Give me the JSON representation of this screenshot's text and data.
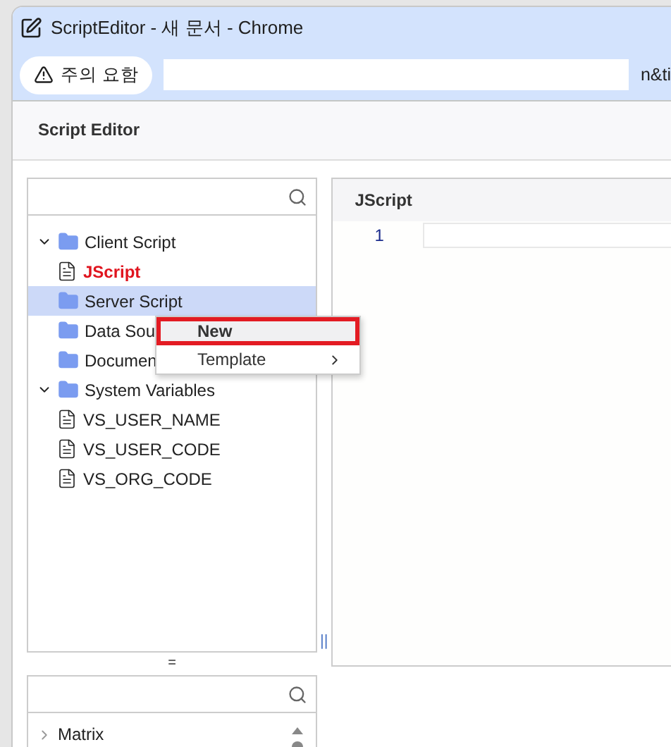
{
  "window": {
    "title": "ScriptEditor - 새 문서 - Chrome"
  },
  "address_bar": {
    "warning": "주의 요함",
    "url_tail": "n&ti"
  },
  "app": {
    "title": "Script Editor"
  },
  "tree": {
    "items": [
      {
        "label": "Client Script",
        "kind": "folder",
        "expanded": true,
        "selected": false,
        "children": [
          {
            "label": "JScript",
            "kind": "file",
            "active": true,
            "selected": false
          }
        ]
      },
      {
        "label": "Server Script",
        "kind": "folder",
        "expanded": false,
        "selected": true
      },
      {
        "label": "Data Sou",
        "kind": "folder",
        "expanded": false,
        "selected": false
      },
      {
        "label": "Documen",
        "kind": "folder",
        "expanded": false,
        "selected": false
      },
      {
        "label": "System Variables",
        "kind": "folder",
        "expanded": true,
        "selected": false,
        "children": [
          {
            "label": "VS_USER_NAME",
            "kind": "file",
            "active": false,
            "selected": false
          },
          {
            "label": "VS_USER_CODE",
            "kind": "file",
            "active": false,
            "selected": false
          },
          {
            "label": "VS_ORG_CODE",
            "kind": "file",
            "active": false,
            "selected": false
          }
        ]
      }
    ]
  },
  "context_menu": {
    "items": [
      {
        "label": "New",
        "selected": true,
        "submenu": false
      },
      {
        "label": "Template",
        "selected": false,
        "submenu": true
      }
    ]
  },
  "splitters": {
    "vertical": "||",
    "horizontal": "="
  },
  "editor": {
    "tab": "JScript",
    "line_numbers": [
      "1"
    ]
  },
  "bottom_list": {
    "items": [
      {
        "label": "Matrix",
        "expanded": false
      }
    ]
  }
}
